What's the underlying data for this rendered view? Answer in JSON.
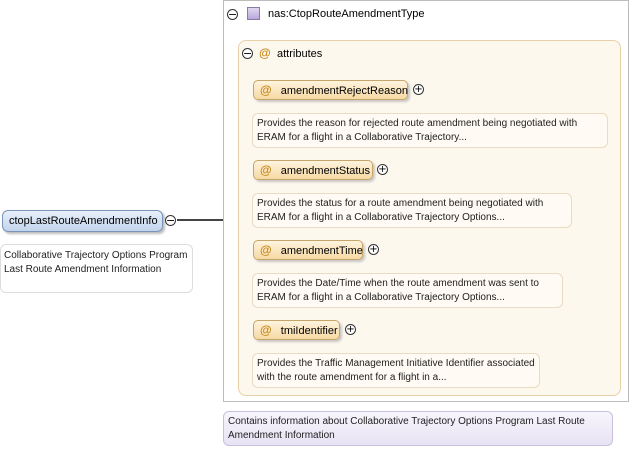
{
  "element": {
    "name": "ctopLastRouteAmendmentInfo",
    "description": "Collaborative Trajectory Options Program Last Route Amendment Information"
  },
  "type": {
    "name": "nas:CtopRouteAmendmentType",
    "description": "Contains information about Collaborative Trajectory Options Program Last Route Amendment Information"
  },
  "attributes_group": {
    "label": "attributes",
    "at_symbol": "@",
    "items": [
      {
        "name": "amendmentRejectReason",
        "description": "Provides the reason for rejected route amendment being negotiated with ERAM for a flight in a Collaborative Trajectory..."
      },
      {
        "name": "amendmentStatus",
        "description": "Provides the status for a route amendment being negotiated with ERAM for a flight in a Collaborative Trajectory Options..."
      },
      {
        "name": "amendmentTime",
        "description": "Provides the Date/Time when the route amendment was sent to ERAM for a flight in a Collaborative Trajectory Options..."
      },
      {
        "name": "tmiIdentifier",
        "description": "Provides the Traffic Management Initiative Identifier associated with the route amendment for a flight in a..."
      }
    ]
  },
  "icons": {
    "collapse": "⊖",
    "expand": "⊕",
    "minus_glyph": "−",
    "plus_glyph": "+"
  },
  "colors": {
    "element_fill": "#c3d4ec",
    "attribute_fill": "#f6d9a4",
    "type_fill": "#e8e3f4"
  }
}
